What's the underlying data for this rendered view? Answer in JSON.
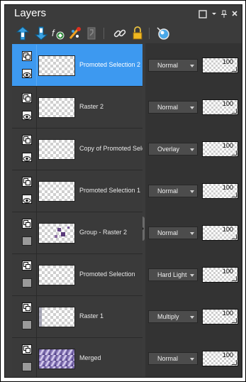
{
  "panel": {
    "title": "Layers"
  },
  "toolbar": {
    "icons": [
      "new-raster-layer-icon",
      "new-vector-layer-icon",
      "new-adjustment-layer-icon",
      "new-mask-layer-icon",
      "mask-icon",
      "link-icon",
      "lock-icon",
      "visibility-toggle-icon"
    ]
  },
  "layers": [
    {
      "name": "Promoted Selection 2",
      "blend": "Normal",
      "opacity": "100",
      "selected": true,
      "visible": true
    },
    {
      "name": "Raster 2",
      "blend": "Normal",
      "opacity": "100",
      "selected": false,
      "visible": true
    },
    {
      "name": "Copy of Promoted Selection",
      "blend": "Overlay",
      "opacity": "100",
      "selected": false,
      "visible": true
    },
    {
      "name": "Promoted Selection 1",
      "blend": "Normal",
      "opacity": "100",
      "selected": false,
      "visible": true
    },
    {
      "name": "Group - Raster 2",
      "blend": "Normal",
      "opacity": "100",
      "selected": false,
      "visible": false
    },
    {
      "name": "Promoted Selection",
      "blend": "Hard Light",
      "opacity": "100",
      "selected": false,
      "visible": false
    },
    {
      "name": "Raster 1",
      "blend": "Multiply",
      "opacity": "100",
      "selected": false,
      "visible": false
    },
    {
      "name": "Merged",
      "blend": "Normal",
      "opacity": "100",
      "selected": false,
      "visible": false
    }
  ],
  "colors": {
    "selection": "#3d99f0",
    "panel": "#3b3b3b"
  }
}
